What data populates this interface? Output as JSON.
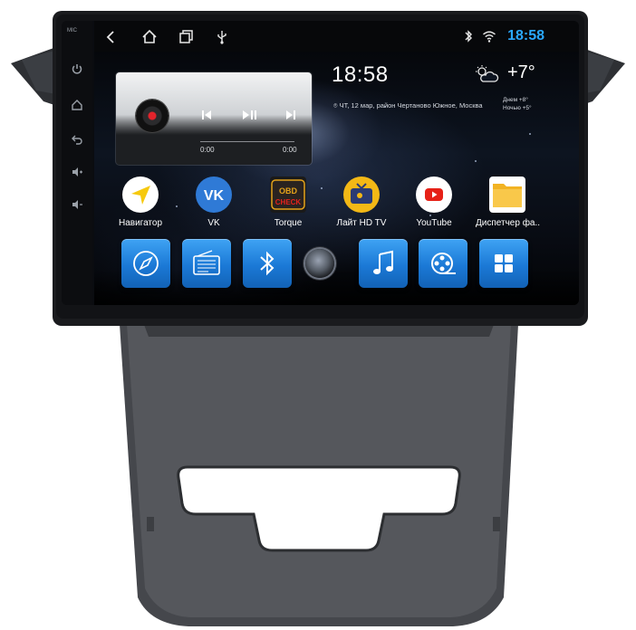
{
  "status_bar": {
    "time": "18:58",
    "nav_icons": [
      "back-icon",
      "home-icon",
      "recent-apps-icon",
      "usb-icon"
    ],
    "status_icons": [
      "bluetooth-icon",
      "wifi-icon"
    ]
  },
  "side_rail": {
    "label": "MIC",
    "icons": [
      "power-icon",
      "home-icon",
      "back-icon",
      "volume-up-icon",
      "volume-down-icon"
    ]
  },
  "media_player": {
    "elapsed": "0:00",
    "total": "0:00",
    "controls": [
      "previous-icon",
      "play-pause-icon",
      "next-icon"
    ]
  },
  "clock_widget": {
    "time": "18:58",
    "date_location": "ЧТ, 12 мар, район Чертаново Южное, Москва"
  },
  "weather": {
    "temperature": "+7°",
    "day": "Днем +8°",
    "night": "Ночью +5°"
  },
  "apps": [
    {
      "label": "Навигатор"
    },
    {
      "label": "VK"
    },
    {
      "label": "Torque"
    },
    {
      "label": "Лайт HD TV"
    },
    {
      "label": "YouTube"
    },
    {
      "label": "Диспетчер фа.."
    }
  ],
  "torque_icon_text": {
    "top": "OBD",
    "bottom": "CHECK"
  },
  "dock": [
    "compass-icon",
    "radio-icon",
    "bluetooth-icon",
    "home-button",
    "music-icon",
    "video-icon",
    "apps-grid-icon"
  ],
  "colors": {
    "accent": "#2aa8ff",
    "dock_blue": "#1b79d6",
    "bezel": "#1d1f22",
    "dash_gray": "#4a4c51"
  }
}
